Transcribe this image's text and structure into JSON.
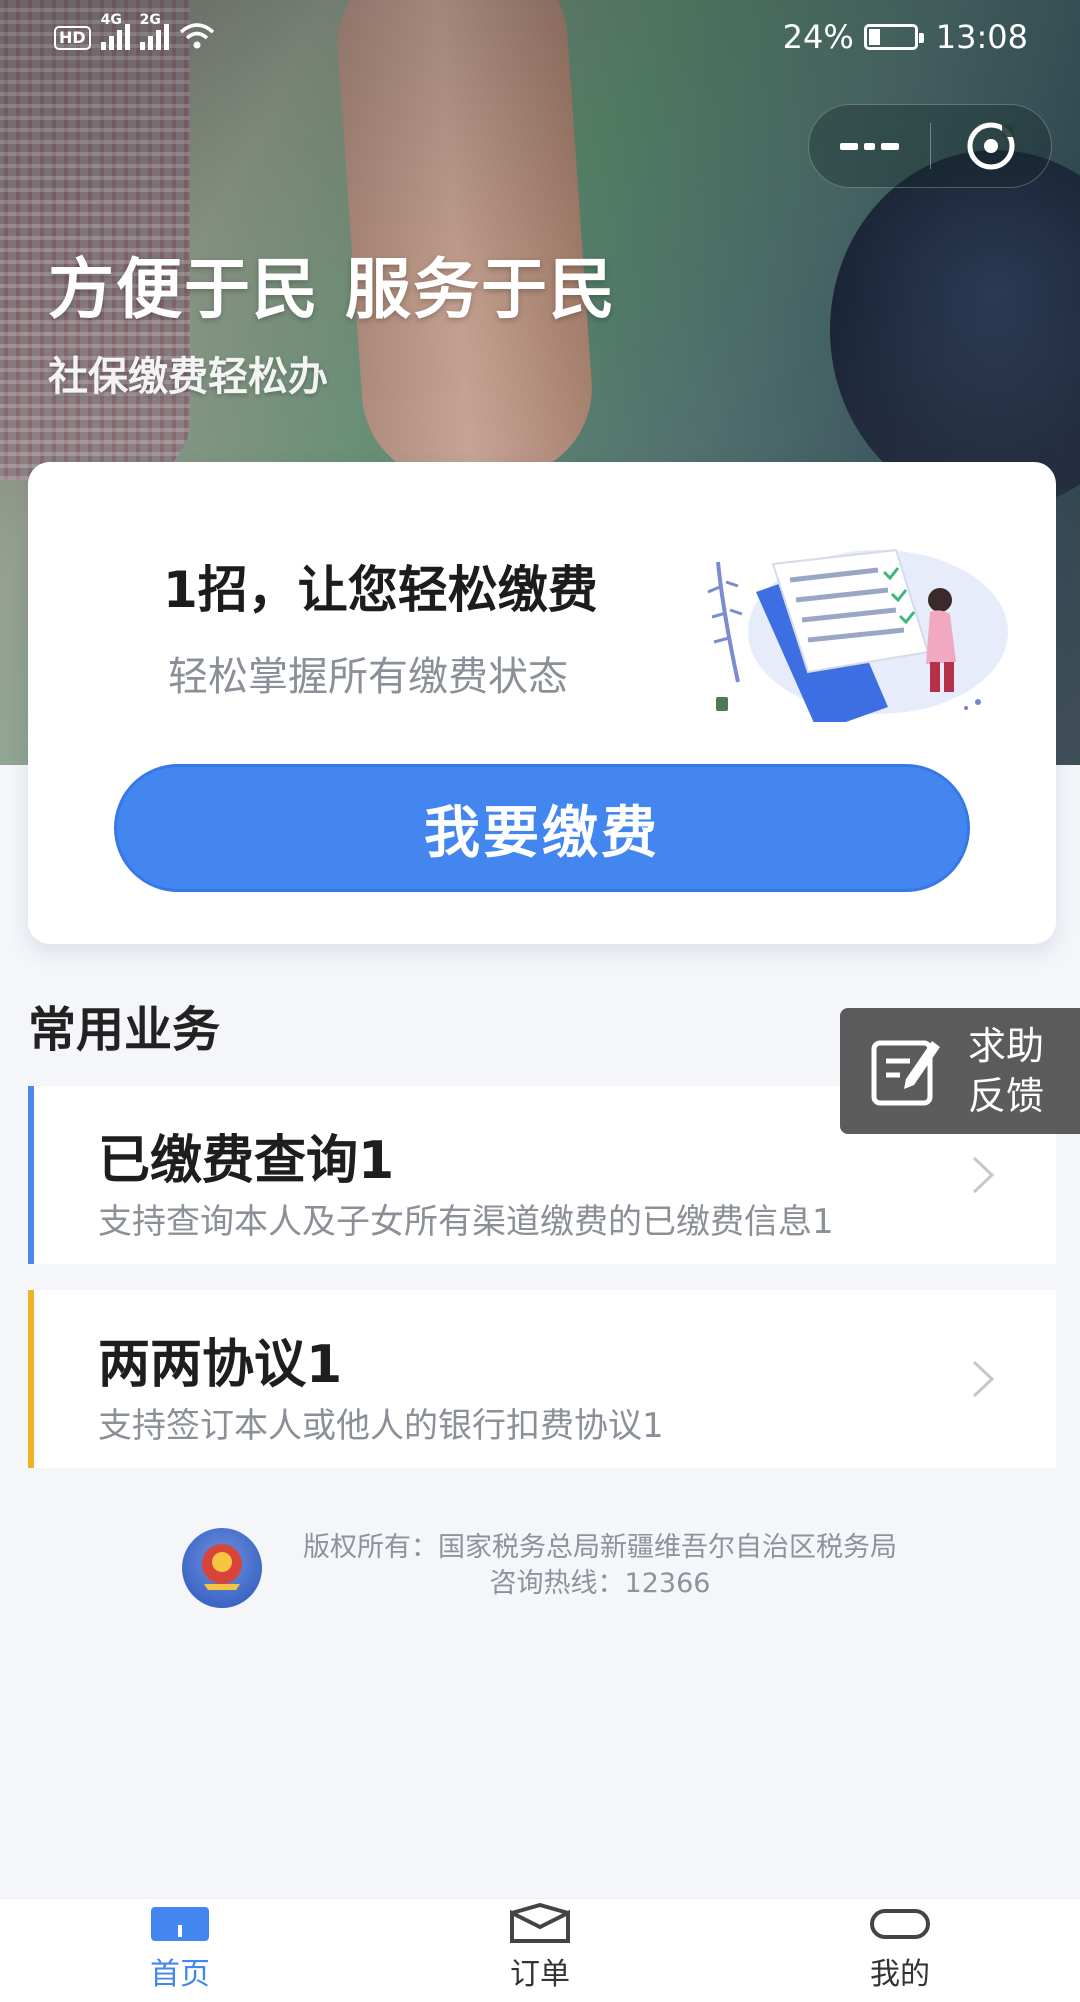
{
  "status_bar": {
    "hd_badge": "HD",
    "network_1": "4G",
    "network_2": "2G",
    "battery_percent": "24%",
    "battery_level": 0.24,
    "time": "13:08"
  },
  "hero": {
    "title": "方便于民 服务于民",
    "subtitle": "社保缴费轻松办"
  },
  "capsule": {
    "more_icon": "more-dots-icon",
    "close_icon": "close-circle-icon"
  },
  "card": {
    "title": "1招，让您轻松缴费",
    "subtitle": "轻松掌握所有缴费状态",
    "pay_button": "我要缴费",
    "accent_color": "#4386f0"
  },
  "section": {
    "title": "常用业务"
  },
  "feedback": {
    "line1": "求助",
    "line2": "反馈"
  },
  "services": [
    {
      "title": "已缴费查询1",
      "desc": "支持查询本人及子女所有渠道缴费的已缴费信息1",
      "accent": "#4a88e8"
    },
    {
      "title": "两两协议1",
      "desc": "支持签订本人或他人的银行扣费协议1",
      "accent": "#f1b22a"
    }
  ],
  "footer": {
    "copyright": "版权所有：国家税务总局新疆维吾尔自治区税务局",
    "hotline": "咨询热线：12366"
  },
  "bottom_nav": [
    {
      "label": "首页",
      "icon": "home-icon",
      "active": true
    },
    {
      "label": "订单",
      "icon": "order-icon",
      "active": false
    },
    {
      "label": "我的",
      "icon": "profile-icon",
      "active": false
    }
  ]
}
